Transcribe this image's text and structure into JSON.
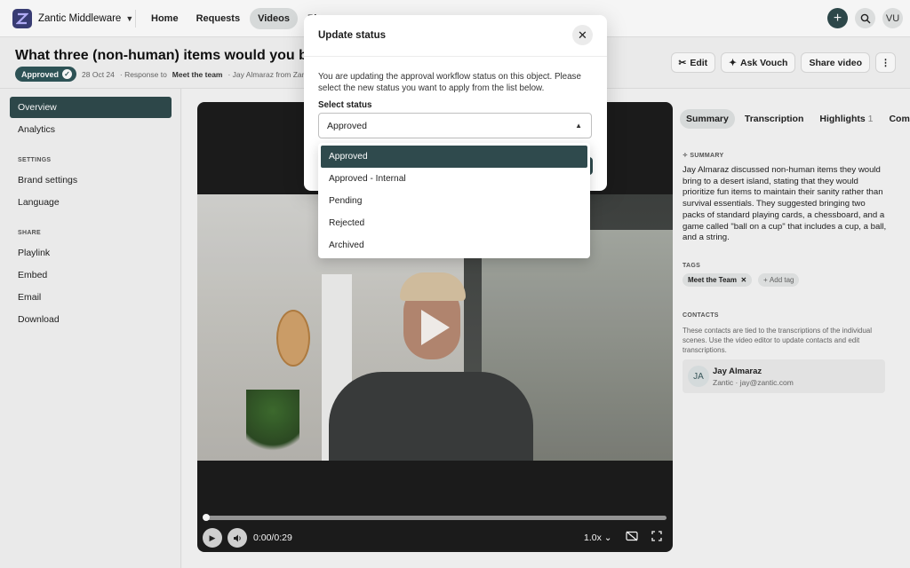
{
  "app": {
    "name": "Zantic Middleware",
    "user_initials": "VU"
  },
  "nav": {
    "tabs": [
      "Home",
      "Requests",
      "Videos",
      "Pla"
    ]
  },
  "video_page": {
    "title": "What three (non-human) items would you bring on a d",
    "status": "Approved",
    "date": "28 Oct 24",
    "response_prefix": "· Response to",
    "response_target": "Meet the team",
    "author": "· Jay Almaraz from Zantic ·",
    "actions": {
      "edit": "Edit",
      "ask": "Ask Vouch",
      "share": "Share video"
    }
  },
  "sidebar": {
    "top_items": [
      "Overview",
      "Analytics"
    ],
    "settings_title": "SETTINGS",
    "settings_items": [
      "Brand settings",
      "Language"
    ],
    "share_title": "SHARE",
    "share_items": [
      "Playlink",
      "Embed",
      "Email",
      "Download"
    ]
  },
  "player": {
    "time": "0:00/0:29",
    "speed": "1.0x",
    "progress": 0
  },
  "right_panel": {
    "tabs": [
      "Summary",
      "Transcription",
      "Highlights",
      "Com"
    ],
    "highlights_count": "1",
    "summary_title": "SUMMARY",
    "summary": "Jay Almaraz discussed non-human items they would bring to a desert island, stating that they would prioritize fun items to maintain their sanity rather than survival essentials. They suggested bringing two packs of standard playing cards, a chessboard, and a game called \"ball on a cup\" that includes a cup, a ball, and a string.",
    "tags_title": "TAGS",
    "tags": [
      "Meet the Team"
    ],
    "add_tag": "Add tag",
    "contacts_title": "CONTACTS",
    "contacts_note": "These contacts are tied to the transcriptions of the individual scenes. Use the video editor to update contacts and edit transcriptions.",
    "contact": {
      "initials": "JA",
      "name": "Jay Almaraz",
      "company": "Zantic",
      "email": "jay@zantic.com",
      "sub": "Zantic · jay@zantic.com"
    }
  },
  "modal": {
    "title": "Update status",
    "description": "You are updating the approval workflow status on this object. Please select the new status you want to apply from the list below.",
    "field_label": "Select status",
    "selected": "Approved",
    "options": [
      "Approved",
      "Approved - Internal",
      "Pending",
      "Rejected",
      "Archived"
    ]
  },
  "colors": {
    "accent": "#2f4a4d",
    "brand": "#3b3f78"
  }
}
